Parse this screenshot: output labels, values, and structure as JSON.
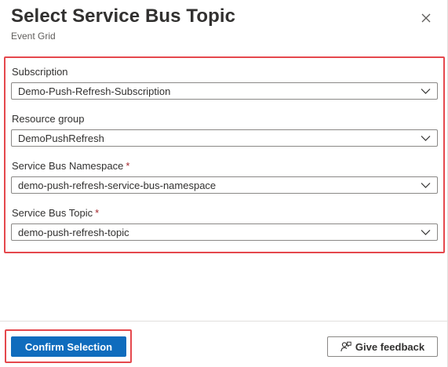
{
  "header": {
    "title": "Select Service Bus Topic",
    "subtitle": "Event Grid",
    "close_icon": "close-icon"
  },
  "form": {
    "fields": [
      {
        "label": "Subscription",
        "required": false,
        "value": "Demo-Push-Refresh-Subscription"
      },
      {
        "label": "Resource group",
        "required": false,
        "value": "DemoPushRefresh"
      },
      {
        "label": "Service Bus Namespace",
        "required": true,
        "value": "demo-push-refresh-service-bus-namespace"
      },
      {
        "label": "Service Bus Topic",
        "required": true,
        "value": "demo-push-refresh-topic"
      }
    ],
    "required_marker": "*",
    "highlight_color": "#e5484d"
  },
  "footer": {
    "confirm_label": "Confirm Selection",
    "feedback_label": "Give feedback",
    "feedback_icon": "feedback-person-icon"
  },
  "colors": {
    "primary": "#0f6cbd",
    "required": "#a4262c",
    "border": "#8a8886",
    "text": "#323130",
    "muted": "#605e5c"
  }
}
